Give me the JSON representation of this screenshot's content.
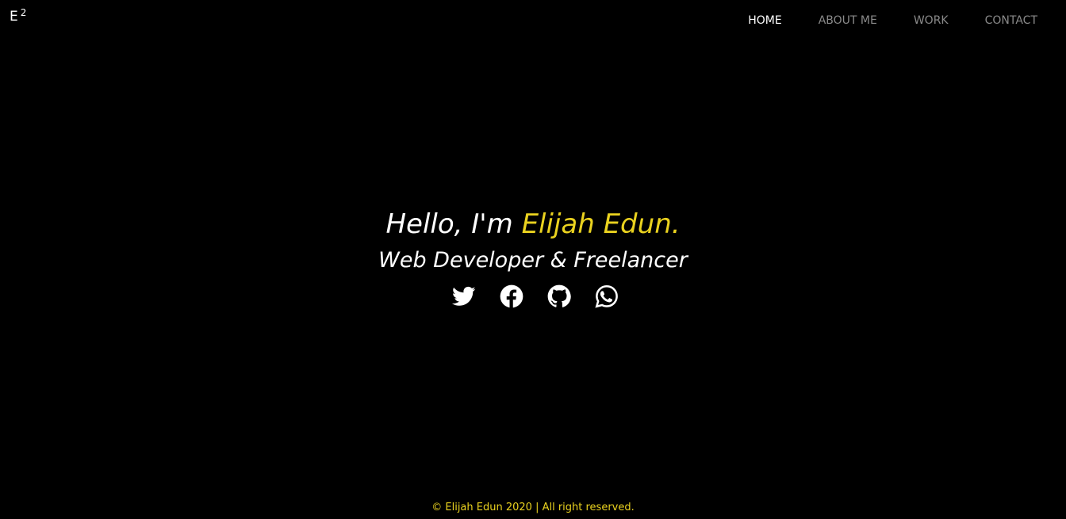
{
  "logo": {
    "letter": "E",
    "superscript": "2"
  },
  "nav": {
    "items": [
      {
        "label": "HOME"
      },
      {
        "label": "ABOUT ME"
      },
      {
        "label": "WORK"
      },
      {
        "label": "CONTACT"
      }
    ],
    "active": "HOME"
  },
  "hero": {
    "greeting": "Hello, I'm ",
    "name": "Elijah Edun.",
    "tagline": "Web Developer & Freelancer",
    "socials": [
      {
        "icon": "twitter-icon"
      },
      {
        "icon": "facebook-icon"
      },
      {
        "icon": "github-icon"
      },
      {
        "icon": "whatsapp-icon"
      }
    ]
  },
  "footer": {
    "text": "© Elijah Edun 2020 | All right reserved."
  },
  "colors": {
    "background": "#000000",
    "accent": "#ead21f",
    "text": "#ffffff",
    "nav_inactive": "#8a8a8a"
  }
}
